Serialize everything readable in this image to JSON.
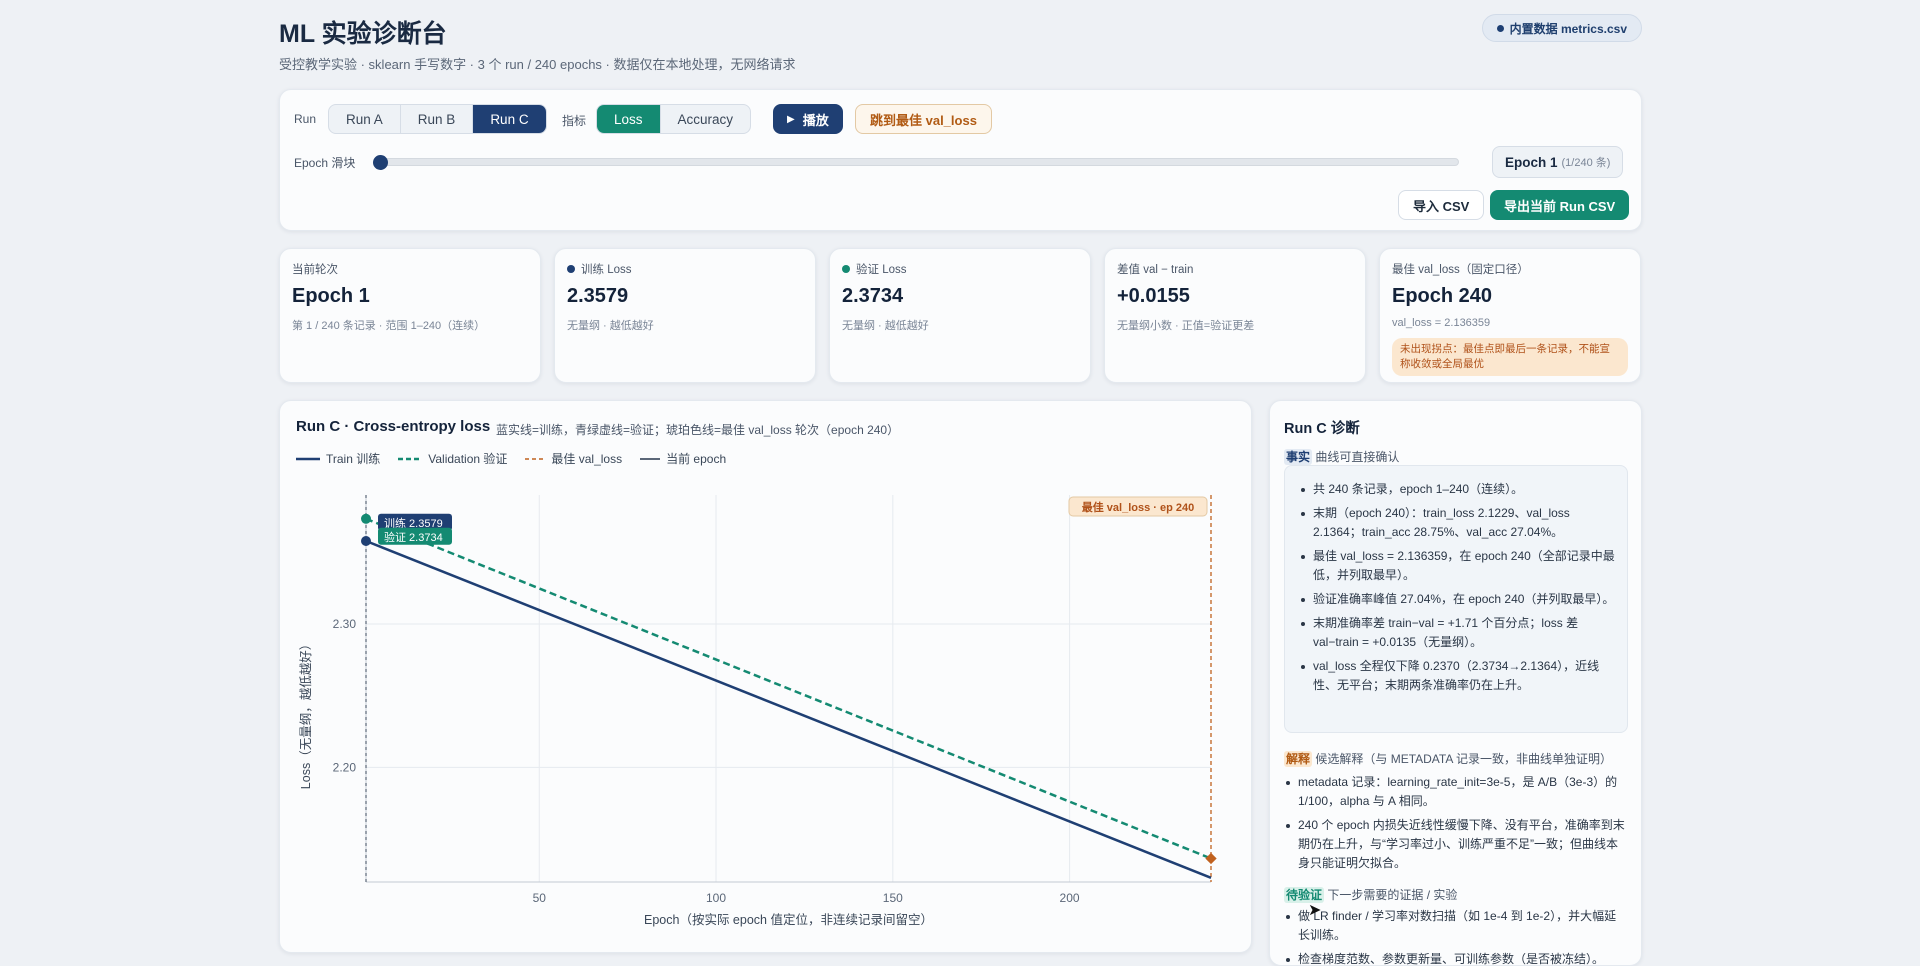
{
  "header": {
    "title": "ML 实验诊断台",
    "subtitle": "受控教学实验 · sklearn 手写数字 · 3 个 run / 240 epochs · 数据仅在本地处理，无网络请求",
    "data_badge": "内置数据 metrics.csv"
  },
  "controls": {
    "run_label": "Run",
    "runs": [
      "Run A",
      "Run B",
      "Run C"
    ],
    "selected_run": "Run C",
    "metric_label": "指标",
    "metrics": [
      "Loss",
      "Accuracy"
    ],
    "selected_metric": "Loss",
    "play_label": "播放",
    "best_button_label": "跳到最佳 val_loss",
    "slider_label": "Epoch 滑块",
    "epoch_value": "Epoch 1",
    "epoch_count": "(1/240 条)",
    "slider_fraction": 0.0,
    "import_label": "导入 CSV",
    "export_label": "导出当前 Run CSV"
  },
  "stats": [
    {
      "label": "当前轮次",
      "value": "Epoch 1",
      "sub": "第 1 / 240 条记录 · 范围 1–240（连续）",
      "dot": ""
    },
    {
      "label": "训练 Loss",
      "value": "2.3579",
      "sub": "无量纲 · 越低越好",
      "dot": "#1f3f73"
    },
    {
      "label": "验证 Loss",
      "value": "2.3734",
      "sub": "无量纲 · 越低越好",
      "dot": "#148a72"
    },
    {
      "label": "差值 val − train",
      "value": "+0.0155",
      "sub": "无量纲小数 · 正值=验证更差",
      "dot": ""
    },
    {
      "label": "最佳 val_loss（固定口径）",
      "value": "Epoch 240",
      "sub": "val_loss = 2.136359",
      "dot": "",
      "warn": "未出现拐点：最佳点即最后一条记录，不能宣称收敛或全局最优"
    }
  ],
  "chart": {
    "title": "Run C · Cross-entropy loss",
    "note": "蓝实线=训练，青绿虚线=验证；琥珀色线=最佳 val_loss 轮次（epoch 240）",
    "legend": [
      "Train 训练",
      "Validation 验证",
      "最佳 val_loss",
      "当前 epoch"
    ],
    "best_label": "最佳 val_loss · ep 240",
    "train_tag": "训练 2.3579",
    "val_tag": "验证 2.3734",
    "xlabel": "Epoch（按实际 epoch 值定位，非连续记录间留空）",
    "ylabel": "Loss（无量纲，越低越好）"
  },
  "chart_data": {
    "type": "line",
    "title": "Run C · Cross-entropy loss",
    "xlabel": "Epoch（按实际 epoch 值定位，非连续记录间留空）",
    "ylabel": "Loss（无量纲，越低越好）",
    "xlim": [
      1,
      240
    ],
    "ylim": [
      2.12,
      2.39
    ],
    "x_ticks": [
      50,
      100,
      150,
      200
    ],
    "y_ticks": [
      2.2,
      2.3
    ],
    "series": [
      {
        "name": "Train 训练",
        "x": [
          1,
          240
        ],
        "y": [
          2.3579,
          2.1229
        ]
      },
      {
        "name": "Validation 验证",
        "x": [
          1,
          240
        ],
        "y": [
          2.3734,
          2.1364
        ]
      }
    ],
    "best_epoch": 240,
    "current_epoch": 1,
    "grid": true,
    "legend_position": "top-left",
    "colors": {
      "train": "#1f3f73",
      "val": "#148a72",
      "best": "#c0611f",
      "current": "#5b6778"
    }
  },
  "diagnosis": {
    "title": "Run C 诊断",
    "facts_tag": "事实",
    "facts_head": "曲线可直接确认",
    "facts": [
      "共 240 条记录，epoch 1–240（连续）。",
      "末期（epoch 240）：train_loss 2.1229、val_loss 2.1364；train_acc 28.75%、val_acc 27.04%。",
      "最佳 val_loss = 2.136359，在 epoch 240（全部记录中最低，并列取最早）。",
      "验证准确率峰值 27.04%，在 epoch 240（并列取最早）。",
      "末期准确率差 train−val = +1.71 个百分点；loss 差 val−train = +0.0135（无量纲）。",
      "val_loss 全程仅下降 0.2370（2.3734→2.1364），近线性、无平台；末期两条准确率仍在上升。"
    ],
    "exp_tag": "解释",
    "exp_head": "候选解释（与 METADATA 记录一致，非曲线单独证明）",
    "explanations": [
      "metadata 记录：learning_rate_init=3e-5，是 A/B（3e-3）的 1/100，alpha 与 A 相同。",
      "240 个 epoch 内损失近线性缓慢下降、没有平台，准确率到末期仍在上升，与“学习率过小、训练严重不足”一致；但曲线本身只能证明欠拟合。"
    ],
    "ver_tag": "待验证",
    "ver_head": "下一步需要的证据 / 实验",
    "verify": [
      "做 LR finder / 学习率对数扫描（如 1e-4 到 1e-2），并大幅延长训练。",
      "检查梯度范数、参数更新量、可训练参数（是否被冻结）。"
    ]
  }
}
